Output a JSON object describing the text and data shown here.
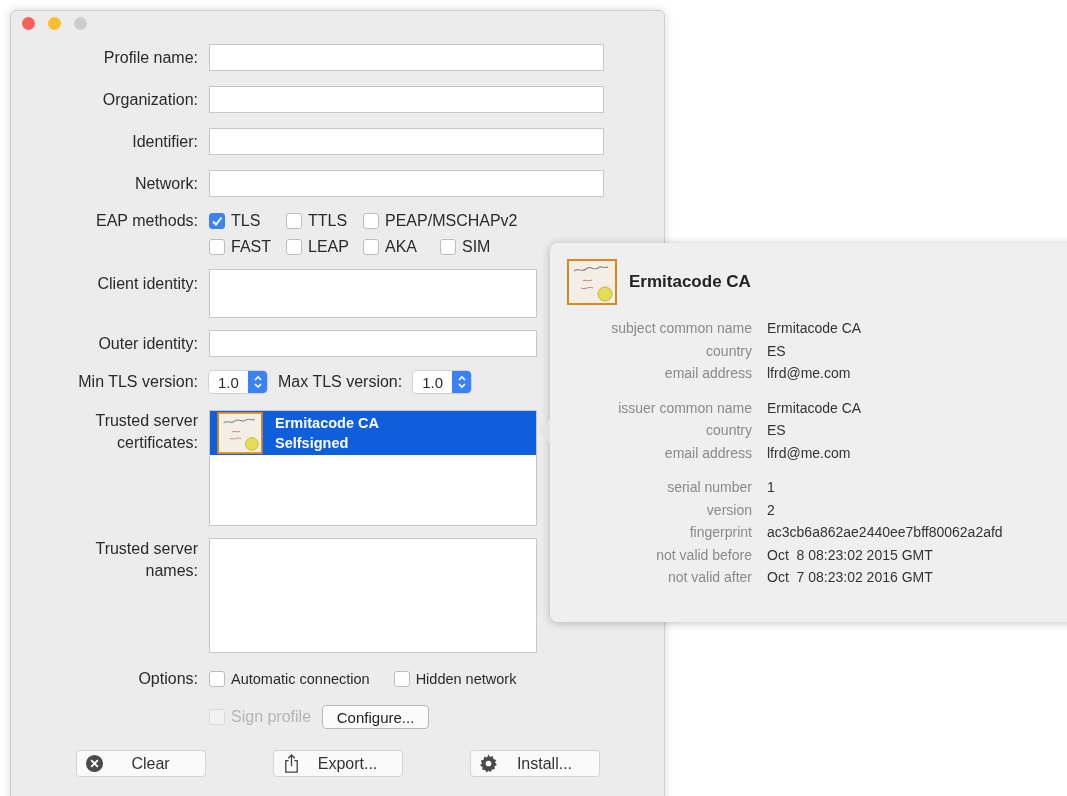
{
  "text_fields": [
    {
      "label": "Profile name:"
    },
    {
      "label": "Organization:"
    },
    {
      "label": "Identifier:"
    },
    {
      "label": "Network:"
    }
  ],
  "eap_methods": {
    "label": "EAP methods:",
    "rows": [
      [
        {
          "label": "TLS",
          "checked": true
        },
        {
          "label": "TTLS",
          "checked": false
        },
        {
          "label": "PEAP/MSCHAPv2",
          "checked": false
        }
      ],
      [
        {
          "label": "FAST",
          "checked": false
        },
        {
          "label": "LEAP",
          "checked": false
        },
        {
          "label": "AKA",
          "checked": false
        },
        {
          "label": "SIM",
          "checked": false
        }
      ]
    ]
  },
  "client_identity": {
    "label": "Client identity:"
  },
  "outer_identity": {
    "label": "Outer identity:"
  },
  "tls": {
    "min_label": "Min TLS version:",
    "min_value": "1.0",
    "max_label": "Max TLS version:",
    "max_value": "1.0"
  },
  "trusted_certificates": {
    "label": "Trusted server certificates:",
    "items": [
      {
        "name": "Ermitacode CA",
        "subtitle": "Selfsigned",
        "selected": true
      }
    ]
  },
  "trusted_server_names": {
    "label": "Trusted server names:"
  },
  "options": {
    "label": "Options:",
    "items": [
      {
        "label": "Automatic connection",
        "checked": false
      },
      {
        "label": "Hidden network",
        "checked": false
      }
    ]
  },
  "sign_profile": {
    "label": "Sign profile",
    "checked": false,
    "disabled": true
  },
  "configure_button": "Configure...",
  "buttons": [
    {
      "label": "Clear",
      "kind": "clear"
    },
    {
      "label": "Export...",
      "kind": "export"
    },
    {
      "label": "Install...",
      "kind": "install"
    }
  ],
  "popover": {
    "title": "Ermitacode CA",
    "groups": [
      [
        {
          "label": "subject common name",
          "value": "Ermitacode CA"
        },
        {
          "label": "country",
          "value": "ES"
        },
        {
          "label": "email address",
          "value": "lfrd@me.com"
        }
      ],
      [
        {
          "label": "issuer common name",
          "value": "Ermitacode CA"
        },
        {
          "label": "country",
          "value": "ES"
        },
        {
          "label": "email address",
          "value": "lfrd@me.com"
        }
      ],
      [
        {
          "label": "serial number",
          "value": "1"
        },
        {
          "label": "version",
          "value": "2"
        },
        {
          "label": "fingerprint",
          "value": "ac3cb6a862ae2440ee7bff80062a2afd"
        },
        {
          "label": "not valid before",
          "value": "Oct  8 08:23:02 2015 GMT"
        },
        {
          "label": "not valid after",
          "value": "Oct  7 08:23:02 2016 GMT"
        }
      ]
    ]
  }
}
